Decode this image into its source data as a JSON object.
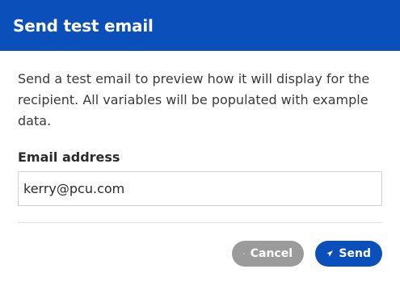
{
  "dialog": {
    "title": "Send test email",
    "description": "Send a test email to preview how it will display for the recipient. All variables will be populated with example data.",
    "email_label": "Email address",
    "email_value": "kerry@pcu.com"
  },
  "footer": {
    "cancel_label": "Cancel",
    "send_label": "Send",
    "cancel_icon": "close-icon",
    "send_icon": "paper-plane-icon"
  },
  "colors": {
    "header": "#0a4fba",
    "send_button": "#0a4fba",
    "cancel_button": "#9b9b9b"
  }
}
